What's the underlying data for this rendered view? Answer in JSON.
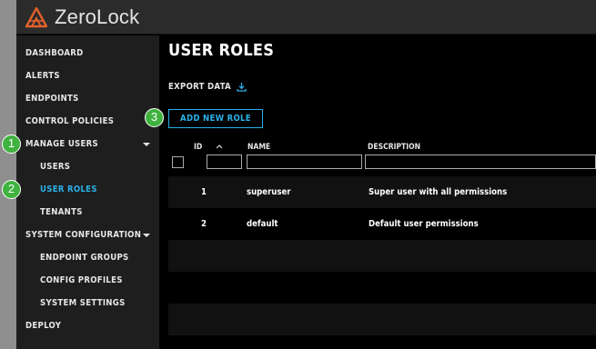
{
  "app": {
    "title": "ZeroLock",
    "brand_color": "#e0612c",
    "accent_color": "#2ab1e8",
    "logo_icon": "zerolock-logo-icon"
  },
  "sidebar": {
    "items": [
      {
        "label": "DASHBOARD",
        "level": "top"
      },
      {
        "label": "ALERTS",
        "level": "top"
      },
      {
        "label": "ENDPOINTS",
        "level": "top"
      },
      {
        "label": "CONTROL POLICIES",
        "level": "top"
      },
      {
        "label": "MANAGE USERS",
        "level": "top",
        "expanded": true
      },
      {
        "label": "USERS",
        "level": "sub"
      },
      {
        "label": "USER ROLES",
        "level": "sub",
        "active": true
      },
      {
        "label": "TENANTS",
        "level": "sub"
      },
      {
        "label": "SYSTEM CONFIGURATION",
        "level": "top",
        "expanded": true
      },
      {
        "label": "ENDPOINT GROUPS",
        "level": "sub"
      },
      {
        "label": "CONFIG PROFILES",
        "level": "sub"
      },
      {
        "label": "SYSTEM SETTINGS",
        "level": "sub"
      },
      {
        "label": "DEPLOY",
        "level": "top"
      }
    ]
  },
  "main": {
    "title": "USER ROLES",
    "export_label": "EXPORT DATA",
    "export_icon": "download-icon",
    "add_button_label": "ADD NEW ROLE",
    "table": {
      "columns": [
        {
          "label": "ID"
        },
        {
          "label": "NAME",
          "sort_icon": "chevron-up-icon"
        },
        {
          "label": "DESCRIPTION"
        }
      ],
      "rows": [
        {
          "id": "1",
          "name": "superuser",
          "description": "Super user with all permissions"
        },
        {
          "id": "2",
          "name": "default",
          "description": "Default user permissions"
        }
      ]
    }
  },
  "annotations": {
    "badge_color": "#3fb23f",
    "badges": [
      {
        "label": "1"
      },
      {
        "label": "2"
      },
      {
        "label": "3"
      }
    ]
  }
}
